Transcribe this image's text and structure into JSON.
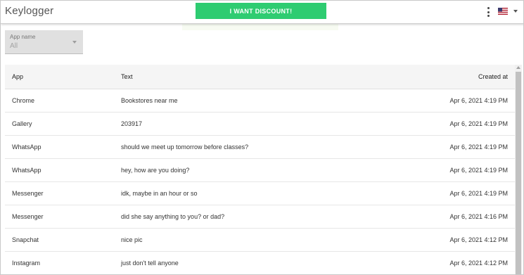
{
  "header": {
    "app_title": "Keylogger",
    "discount_label": "I WANT DISCOUNT!",
    "discount_color": "#2ecc71",
    "menu_icon": "more-vert-icon",
    "flag_icon": "us-flag-icon"
  },
  "filter": {
    "label": "App name",
    "value": "All"
  },
  "table": {
    "columns": {
      "app": "App",
      "text": "Text",
      "created": "Created at"
    },
    "rows": [
      {
        "app": "Chrome",
        "text": "Bookstores near me",
        "created": "Apr 6, 2021 4:19 PM"
      },
      {
        "app": "Gallery",
        "text": "203917",
        "created": "Apr 6, 2021 4:19 PM"
      },
      {
        "app": "WhatsApp",
        "text": "should we meet up tomorrow before classes?",
        "created": "Apr 6, 2021 4:19 PM"
      },
      {
        "app": "WhatsApp",
        "text": "hey, how are you doing?",
        "created": "Apr 6, 2021 4:19 PM"
      },
      {
        "app": "Messenger",
        "text": "idk, maybe in an hour or so",
        "created": "Apr 6, 2021 4:19 PM"
      },
      {
        "app": "Messenger",
        "text": "did she say anything to you? or dad?",
        "created": "Apr 6, 2021 4:16 PM"
      },
      {
        "app": "Snapchat",
        "text": "nice pic",
        "created": "Apr 6, 2021 4:12 PM"
      },
      {
        "app": "Instagram",
        "text": "just don't tell anyone",
        "created": "Apr 6, 2021 4:12 PM"
      }
    ]
  }
}
